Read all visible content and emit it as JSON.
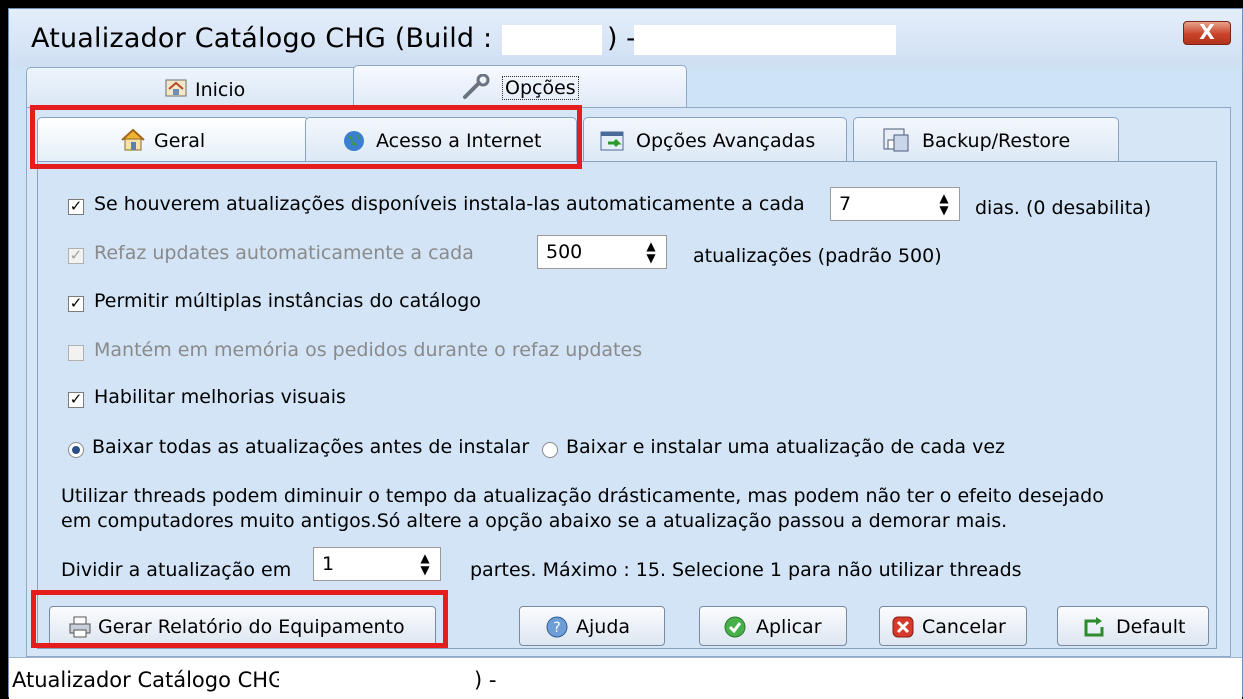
{
  "window": {
    "title_prefix": "Atualizador Catálogo CHG  (Build :",
    "title_dash": ") -",
    "close_label": "X"
  },
  "main_tabs": [
    {
      "label": "Inicio",
      "icon": "house-icon",
      "active": false
    },
    {
      "label": "Opções",
      "icon": "wrench-icon",
      "active": true
    }
  ],
  "sub_tabs": [
    {
      "label": "Geral",
      "icon": "house-icon",
      "active": true
    },
    {
      "label": "Acesso a Internet",
      "icon": "globe-icon",
      "active": false
    },
    {
      "label": "Opções Avançadas",
      "icon": "arrow-window-icon",
      "active": false
    },
    {
      "label": "Backup/Restore",
      "icon": "floppy-icon",
      "active": false
    }
  ],
  "options": {
    "auto_install": {
      "label": "Se houverem atualizações disponíveis instala-las automaticamente a cada",
      "checked": true,
      "value": "7",
      "suffix": "dias. (0 desabilita)"
    },
    "refaz_updates": {
      "label": "Refaz updates automaticamente a cada",
      "checked": true,
      "enabled": false,
      "value": "500",
      "suffix": "atualizações (padrão 500)"
    },
    "multi_instances": {
      "label": "Permitir múltiplas instâncias do catálogo",
      "checked": true
    },
    "keep_orders": {
      "label": "Mantém em memória os pedidos durante o refaz updates",
      "checked": false,
      "enabled": false
    },
    "visual_improvements": {
      "label": "Habilitar melhorias visuais",
      "checked": true
    },
    "download_mode": {
      "options": [
        "Baixar todas as atualizações antes de instalar",
        "Baixar e instalar uma atualização de cada vez"
      ],
      "selected": 0
    },
    "threads_note_line1": "Utilizar threads podem diminuir o tempo da atualização drásticamente, mas podem não ter o efeito desejado",
    "threads_note_line2": "em computadores muito antigos.Só altere a opção abaixo se a atualização passou a demorar mais.",
    "split": {
      "label": "Dividir a atualização em",
      "value": "1",
      "suffix": "partes. Máximo : 15. Selecione 1 para não utilizar threads"
    }
  },
  "buttons": {
    "report": "Gerar Relatório do Equipamento",
    "help": "Ajuda",
    "apply": "Aplicar",
    "cancel": "Cancelar",
    "default": "Default"
  },
  "status_bar": {
    "prefix": "Atualizador Catálogo CHG  (Build :",
    "dash": ") -"
  },
  "colors": {
    "highlight": "#e51d1d",
    "panel": "#d2e4f6"
  }
}
